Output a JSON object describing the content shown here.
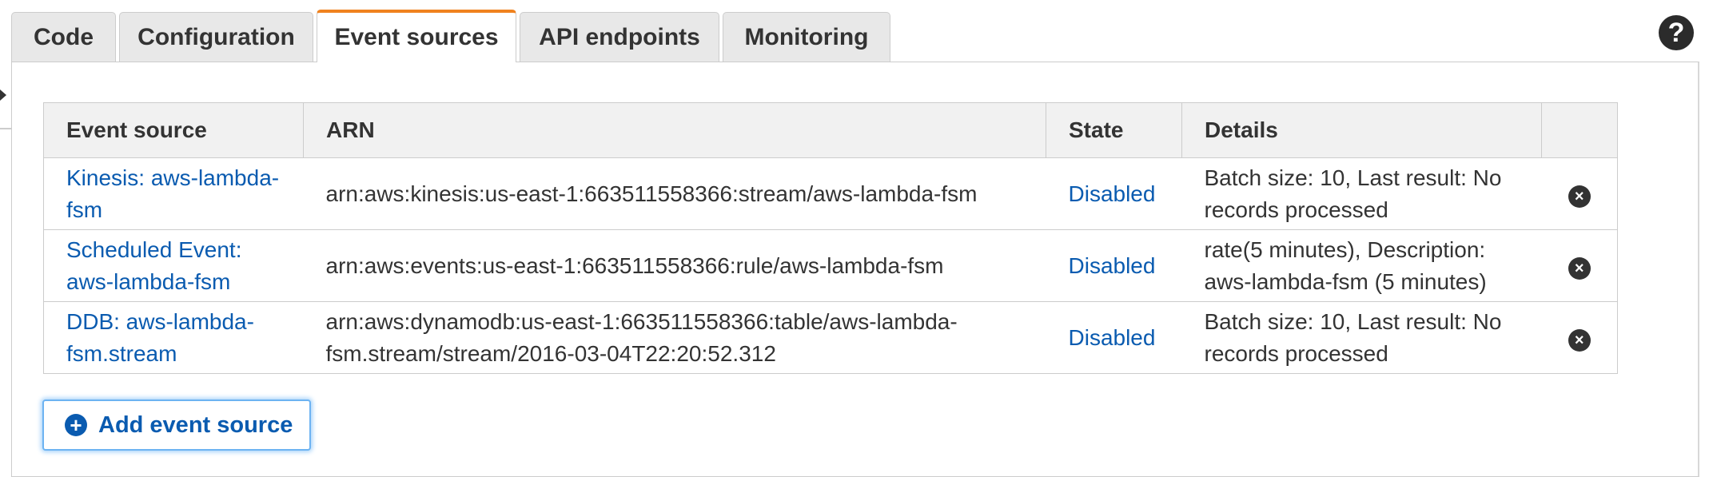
{
  "tabs": [
    {
      "label": "Code"
    },
    {
      "label": "Configuration"
    },
    {
      "label": "Event sources",
      "active": true
    },
    {
      "label": "API endpoints"
    },
    {
      "label": "Monitoring"
    }
  ],
  "help": {
    "glyph": "?",
    "icon": "help-icon"
  },
  "table": {
    "headers": {
      "event_source": "Event source",
      "arn": "ARN",
      "state": "State",
      "details": "Details",
      "actions": ""
    },
    "rows": [
      {
        "event_source": "Kinesis: aws-lambda-fsm",
        "arn": "arn:aws:kinesis:us-east-1:663511558366:stream/aws-lambda-fsm",
        "state": "Disabled",
        "details": "Batch size: 10, Last result: No records processed"
      },
      {
        "event_source": "Scheduled Event: aws-lambda-fsm",
        "arn": "arn:aws:events:us-east-1:663511558366:rule/aws-lambda-fsm",
        "state": "Disabled",
        "details": "rate(5 minutes), Description: aws-lambda-fsm (5 minutes)"
      },
      {
        "event_source": "DDB: aws-lambda-fsm.stream",
        "arn": "arn:aws:dynamodb:us-east-1:663511558366:table/aws-lambda-fsm.stream/stream/2016-03-04T22:20:52.312",
        "state": "Disabled",
        "details": "Batch size: 10, Last result: No records processed"
      }
    ],
    "remove_glyph": "×"
  },
  "add_button": {
    "label": "Add event source",
    "glyph": "+"
  },
  "colors": {
    "active_tab_accent": "#f0821e",
    "link": "#0a5bb0",
    "focus_ring": "#6db3f2"
  }
}
